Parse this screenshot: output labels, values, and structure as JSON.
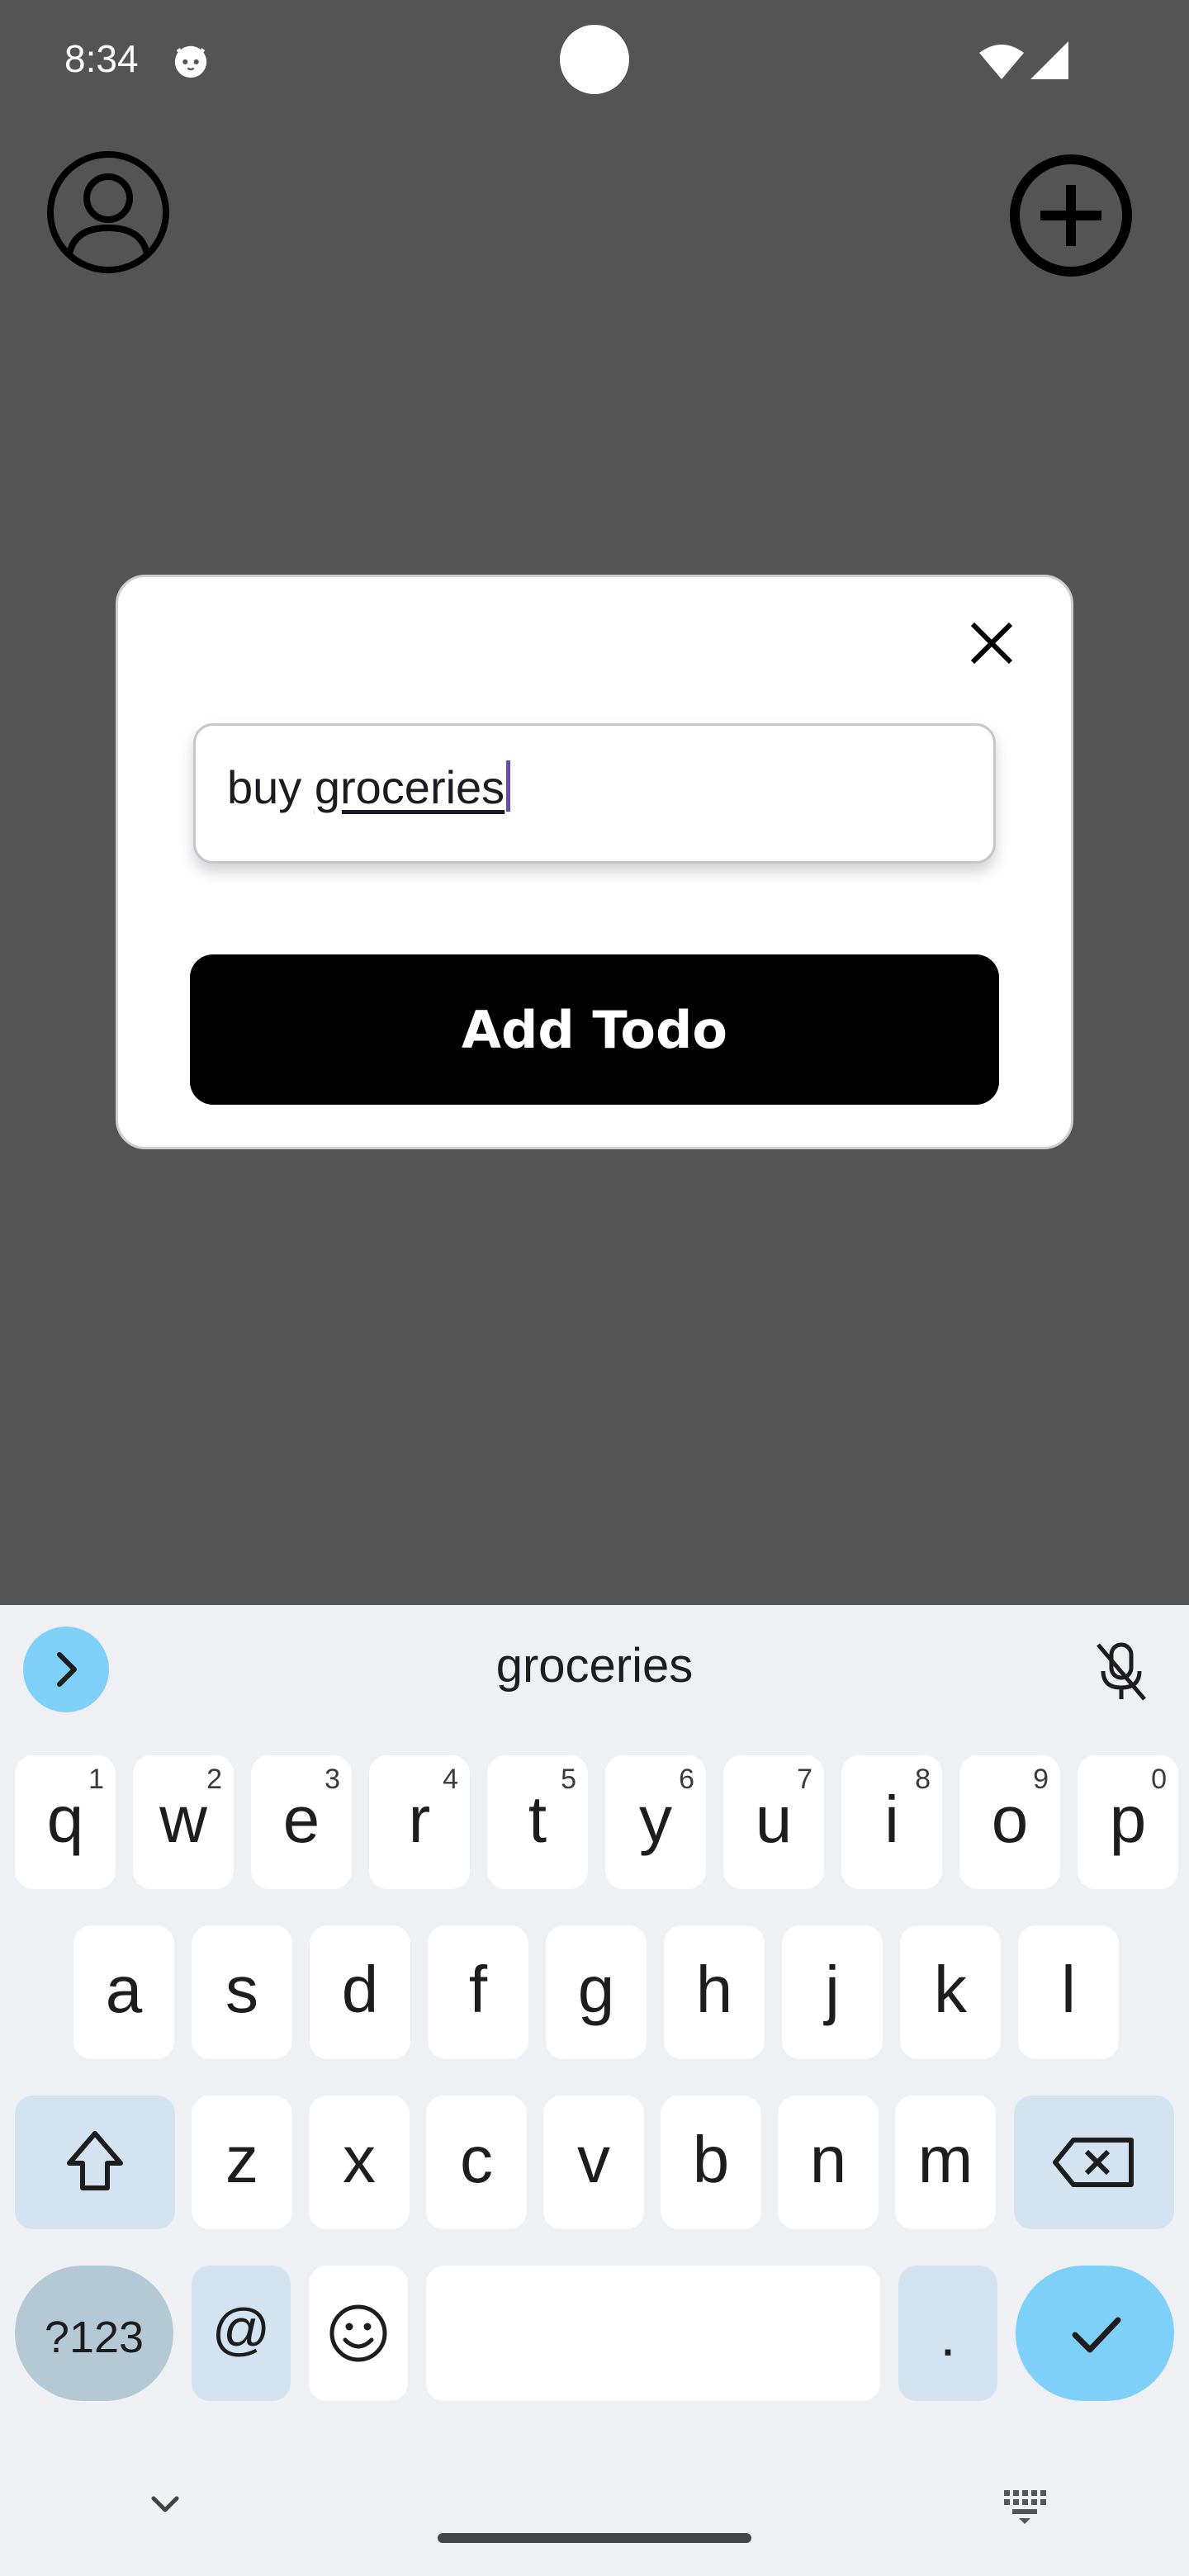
{
  "status_bar": {
    "time": "8:34",
    "icons": [
      "cat-notification-icon",
      "wifi-icon",
      "signal-icon"
    ]
  },
  "app_bar": {
    "icons": [
      "account-circle-icon",
      "add-circle-icon"
    ]
  },
  "dialog": {
    "close_icon": "close-icon",
    "input_value_plain": "buy ",
    "input_value_composing": "groceries",
    "button_label": "Add Todo"
  },
  "keyboard": {
    "suggestion": "groceries",
    "row1": [
      {
        "char": "q",
        "num": "1"
      },
      {
        "char": "w",
        "num": "2"
      },
      {
        "char": "e",
        "num": "3"
      },
      {
        "char": "r",
        "num": "4"
      },
      {
        "char": "t",
        "num": "5"
      },
      {
        "char": "y",
        "num": "6"
      },
      {
        "char": "u",
        "num": "7"
      },
      {
        "char": "i",
        "num": "8"
      },
      {
        "char": "o",
        "num": "9"
      },
      {
        "char": "p",
        "num": "0"
      }
    ],
    "row2": [
      "a",
      "s",
      "d",
      "f",
      "g",
      "h",
      "j",
      "k",
      "l"
    ],
    "row3": [
      "z",
      "x",
      "c",
      "v",
      "b",
      "n",
      "m"
    ],
    "symbols_label": "?123",
    "at_label": "@",
    "period_label": ".",
    "icons": [
      "chevron-right-icon",
      "mic-off-icon",
      "shift-icon",
      "backspace-icon",
      "emoji-icon",
      "check-icon",
      "chevron-down-icon",
      "keyboard-icon"
    ]
  },
  "colors": {
    "app_background": "#545454",
    "keyboard_background": "#eef0f4",
    "accent_blue": "#7fd0f8",
    "function_key": "#d3e3f2",
    "caret": "#6a4bb0"
  }
}
